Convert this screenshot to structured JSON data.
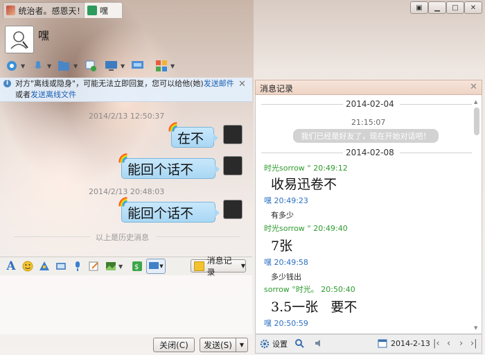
{
  "window": {
    "tabs": [
      {
        "label": "统治者。感恩天！"
      },
      {
        "label": "嘿"
      }
    ],
    "controls": [
      "restore",
      "minimize",
      "maximize",
      "close"
    ]
  },
  "contact": {
    "name": "嘿"
  },
  "notice": {
    "text_prefix": "对方\"离线或隐身\"，可能无法立即回复，您可以给他(她)",
    "link_email": "发送邮件",
    "text_or": "或者",
    "link_file": "发送离线文件"
  },
  "history": {
    "messages": [
      {
        "time": "2014/2/13 12:50:37",
        "text": "在不"
      },
      {
        "text": "能回个话不"
      },
      {
        "time": "2014/2/13 20:48:03",
        "text": "能回个话不"
      }
    ],
    "separator": "以上是历史消息"
  },
  "input_toolbar": {
    "message_record_label": "消息记录"
  },
  "buttons": {
    "close": "关闭(C)",
    "send": "发送(S)"
  },
  "record_panel": {
    "title": "消息记录",
    "entries": {
      "date1": "2014-02-04",
      "time1": "21:15:07",
      "system": "我们已经是好友了，现在开始对话吧！",
      "date2": "2014-02-08",
      "s1": "时光sorrow °  20:49:12",
      "m1": "收易迅卷不",
      "s2": "嘿  20:49:23",
      "m2": "有多少",
      "s3": "时光sorrow °  20:49:40",
      "m3": "7张",
      "s4": "嘿  20:49:58",
      "m4": "多少钱出",
      "s5": "sorrow °时光。 20:50:40",
      "m5": "3.5一张   要不",
      "s6": "嘿  20:50:59"
    },
    "footer": {
      "settings": "设置",
      "date": "2014-2-13"
    }
  },
  "colors": {
    "bubble": "#b6def7",
    "green_sender": "#2e9b2e",
    "blue_sender": "#2a6fc1",
    "link": "#1a5fb4"
  }
}
